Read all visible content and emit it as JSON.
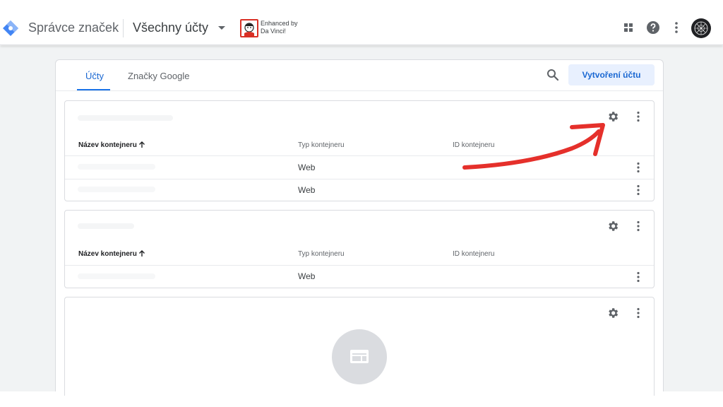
{
  "header": {
    "app_title": "Správce značek",
    "account_selector": "Všechny účty",
    "extension_badge": {
      "line1": "Enhanced by",
      "line2": "Da Vinci!"
    },
    "icons": [
      "apps-icon",
      "help-icon",
      "more-vert-icon"
    ]
  },
  "tabs": [
    {
      "label": "Účty",
      "active": true
    },
    {
      "label": "Značky Google",
      "active": false
    }
  ],
  "toolbar": {
    "create_label": "Vytvoření účtu"
  },
  "table_headers": {
    "name": "Název kontejneru",
    "type": "Typ kontejneru",
    "id": "ID kontejneru"
  },
  "accounts": [
    {
      "rows": [
        {
          "type": "Web"
        },
        {
          "type": "Web"
        }
      ]
    },
    {
      "rows": [
        {
          "type": "Web"
        }
      ]
    },
    {
      "rows": []
    }
  ],
  "colors": {
    "accent": "#1a73e8",
    "annotation": "#e5302b",
    "logo_blue": "#4285f4"
  }
}
